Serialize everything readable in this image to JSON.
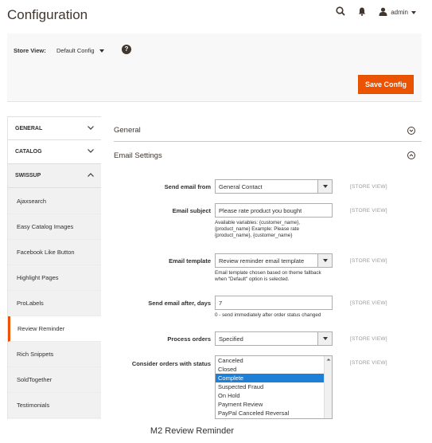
{
  "header": {
    "title": "Configuration",
    "user": "admin"
  },
  "scope": {
    "label": "Store View:",
    "value": "Default Config",
    "help": "?"
  },
  "actions": {
    "save_label": "Save Config"
  },
  "sidebar": {
    "groups": [
      {
        "label": "GENERAL"
      },
      {
        "label": "CATALOG"
      },
      {
        "label": "SWISSUP"
      }
    ],
    "items": [
      {
        "label": "Ajaxsearch"
      },
      {
        "label": "Easy Catalog Images"
      },
      {
        "label": "Facebook Like Button"
      },
      {
        "label": "Highlight Pages"
      },
      {
        "label": "ProLabels"
      },
      {
        "label": "Review Reminder"
      },
      {
        "label": "Rich Snippets"
      },
      {
        "label": "SoldTogether"
      },
      {
        "label": "Testimonials"
      }
    ]
  },
  "sections": {
    "general": "General",
    "email": "Email Settings"
  },
  "fields": {
    "send_from": {
      "label": "Send email from",
      "value": "General Contact",
      "scope": "[STORE VIEW]"
    },
    "subject": {
      "label": "Email subject",
      "value": "Please rate product you bought",
      "scope": "[STORE VIEW]",
      "note1": "Available variables: {customer_name},",
      "note2": "{product_name} Example: Please rate",
      "note3": "{product_name}, {customer_name}"
    },
    "template": {
      "label": "Email template",
      "value": "Review reminder email template",
      "scope": "[STORE VIEW]",
      "note1": "Email template chosen based on theme fallback",
      "note2": "when \"Default\" option is selected."
    },
    "after_days": {
      "label": "Send email after, days",
      "value": "7",
      "scope": "[STORE VIEW]",
      "note": "0 - send immediately after order status changed"
    },
    "process_orders": {
      "label": "Process orders",
      "value": "Specified",
      "scope": "[STORE VIEW]"
    },
    "consider_status": {
      "label": "Consider orders with status",
      "scope": "[STORE VIEW]",
      "options": [
        "Canceled",
        "Closed",
        "Complete",
        "Suspected Fraud",
        "On Hold",
        "Payment Review",
        "PayPal Canceled Reversal"
      ],
      "selected": "Complete"
    }
  },
  "caption": "M2 Review Reminder"
}
